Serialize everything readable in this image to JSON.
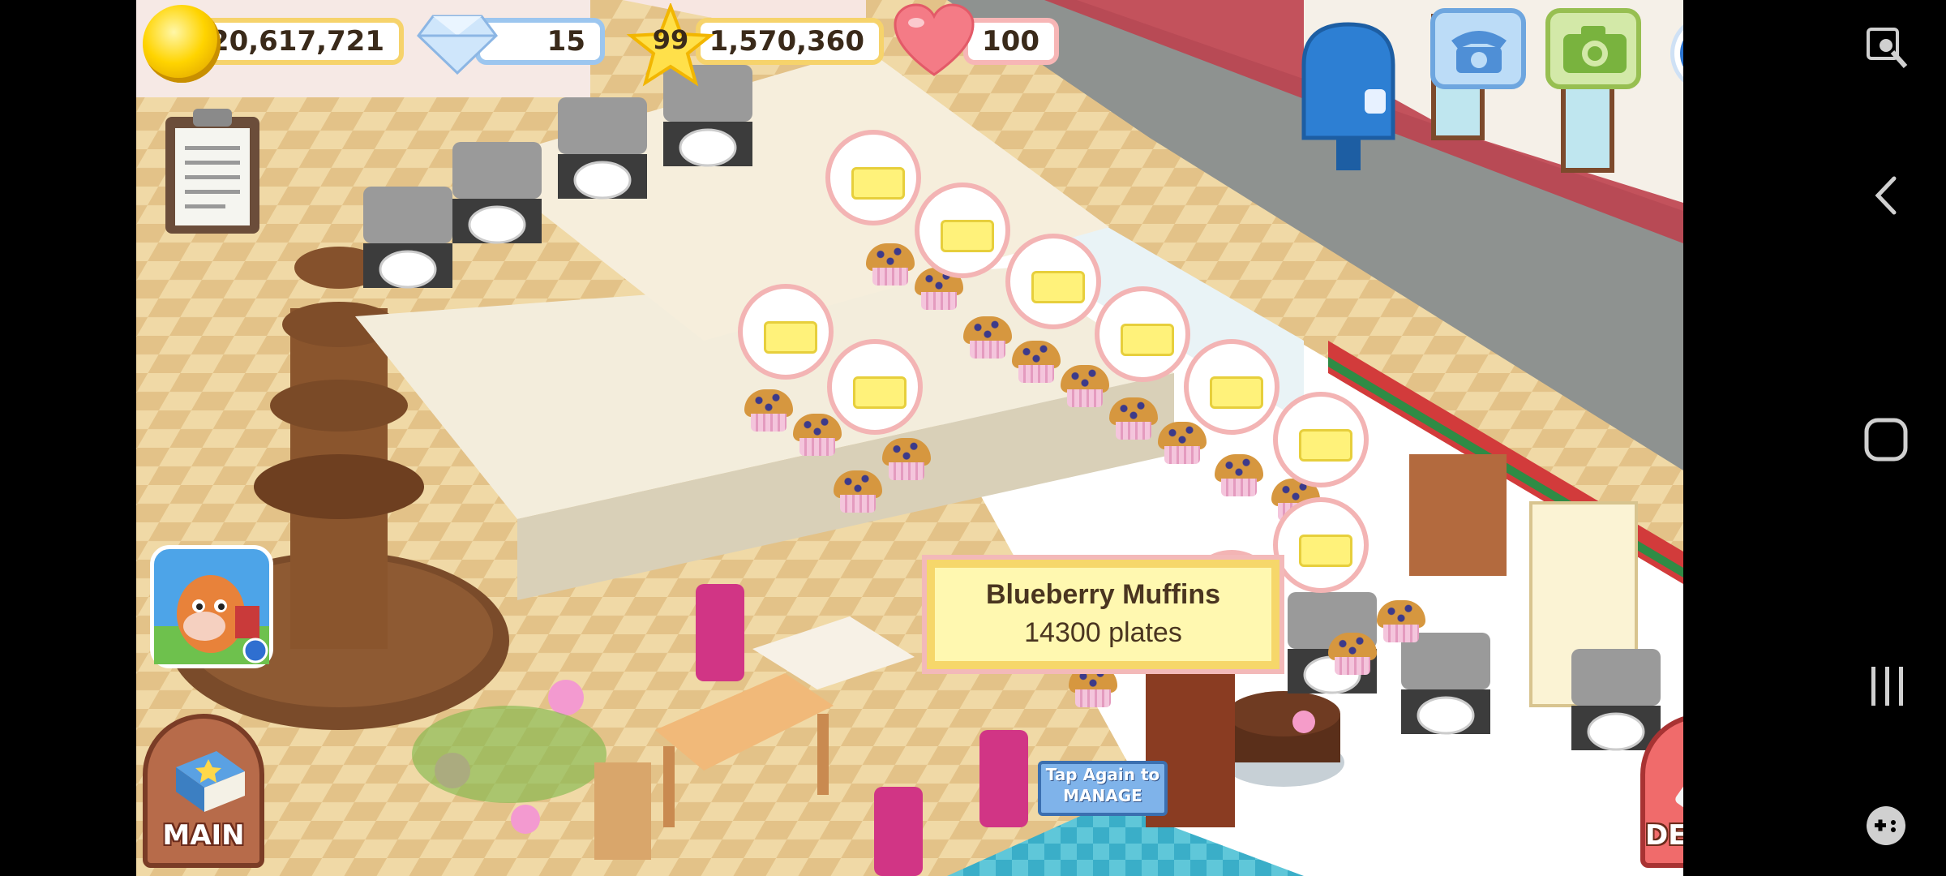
{
  "hud": {
    "coins": "20,617,721",
    "gems": "15",
    "level": "99",
    "experience": "1,570,360",
    "hearts": "100"
  },
  "tooltip": {
    "item_name": "Blueberry Muffins",
    "plates": "14300 plates"
  },
  "tap_button": {
    "line1": "Tap Again to",
    "line2": "MANAGE"
  },
  "buttons": {
    "main_label": "MAIN",
    "design_label": "DESIGN"
  },
  "icons": {
    "coin": "coin-icon",
    "gem": "diamond-icon",
    "star": "star-icon",
    "heart": "heart-icon",
    "mailbox": "mailbox-icon",
    "phone": "phone-icon",
    "camera": "camera-icon",
    "teamlava": "teamlava-icon",
    "clipboard": "clipboard-icon",
    "promo_app": "cow-app-icon"
  },
  "system_nav": {
    "items": [
      "screenshot-tool-icon",
      "back-icon",
      "home-icon",
      "recents-icon",
      "game-controller-icon"
    ]
  },
  "colors": {
    "hud_gold": "#f6d36b",
    "hud_blue": "#9cc6ef",
    "hud_pink": "#f7b6b6",
    "tooltip_bg": "#fff8b0",
    "tap_button": "#7fb3ea"
  }
}
